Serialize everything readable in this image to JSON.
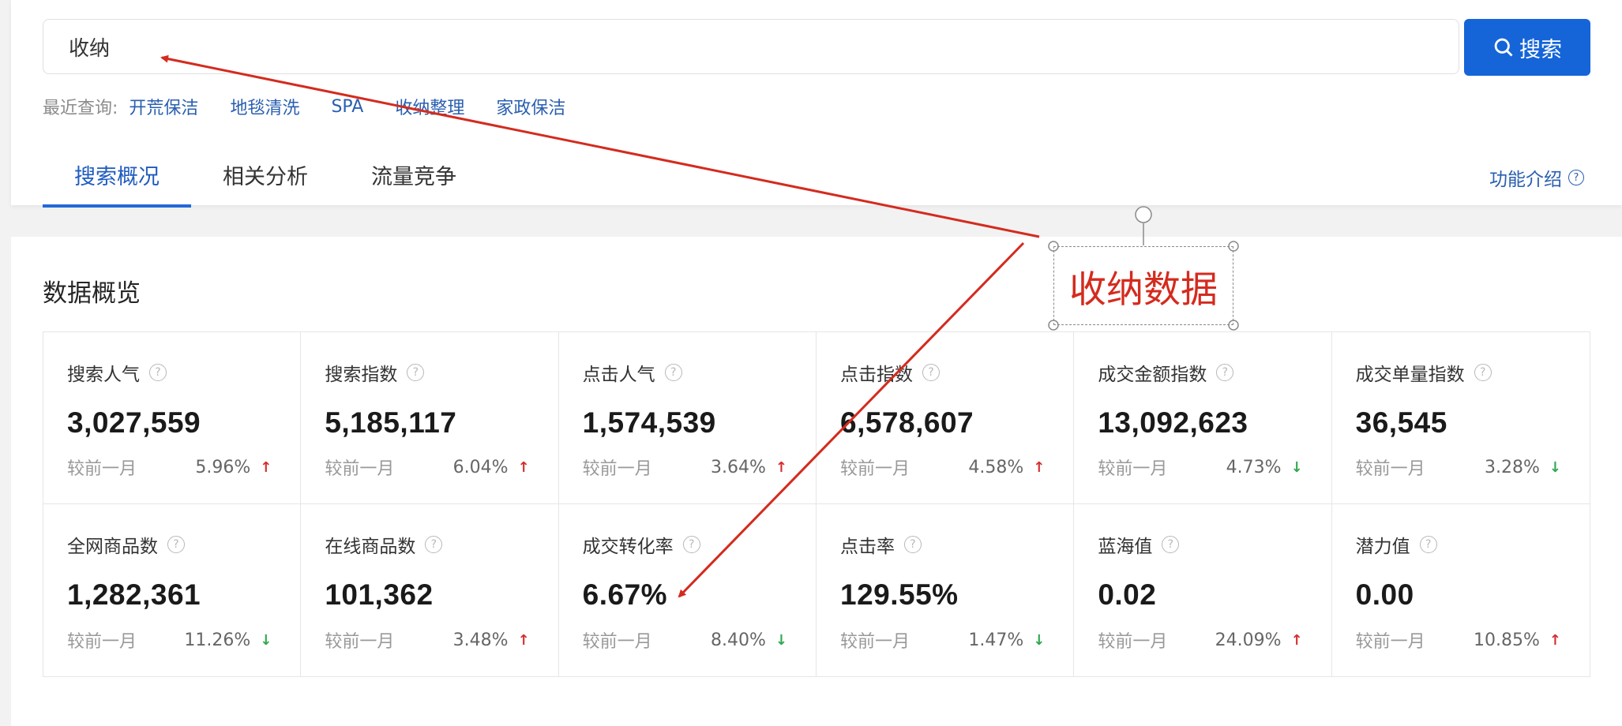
{
  "search": {
    "value": "收纳",
    "button_label": "搜索"
  },
  "recent": {
    "label": "最近查询:",
    "links": [
      "开荒保洁",
      "地毯清洗",
      "SPA",
      "收纳整理",
      "家政保洁"
    ]
  },
  "tabs": [
    {
      "label": "搜索概况",
      "active": true
    },
    {
      "label": "相关分析",
      "active": false
    },
    {
      "label": "流量竞争",
      "active": false
    }
  ],
  "func_intro": {
    "label": "功能介绍",
    "icon": "question-circle-icon"
  },
  "overview": {
    "title": "数据概览",
    "compare_label": "较前一月",
    "metrics": [
      {
        "label": "搜索人气",
        "value": "3,027,559",
        "change": "5.96%",
        "trend": "up"
      },
      {
        "label": "搜索指数",
        "value": "5,185,117",
        "change": "6.04%",
        "trend": "up"
      },
      {
        "label": "点击人气",
        "value": "1,574,539",
        "change": "3.64%",
        "trend": "up"
      },
      {
        "label": "点击指数",
        "value": "6,578,607",
        "change": "4.58%",
        "trend": "up"
      },
      {
        "label": "成交金额指数",
        "value": "13,092,623",
        "change": "4.73%",
        "trend": "down"
      },
      {
        "label": "成交单量指数",
        "value": "36,545",
        "change": "3.28%",
        "trend": "down"
      },
      {
        "label": "全网商品数",
        "value": "1,282,361",
        "change": "11.26%",
        "trend": "down"
      },
      {
        "label": "在线商品数",
        "value": "101,362",
        "change": "3.48%",
        "trend": "up"
      },
      {
        "label": "成交转化率",
        "value": "6.67%",
        "change": "8.40%",
        "trend": "down"
      },
      {
        "label": "点击率",
        "value": "129.55%",
        "change": "1.47%",
        "trend": "down"
      },
      {
        "label": "蓝海值",
        "value": "0.02",
        "change": "24.09%",
        "trend": "up"
      },
      {
        "label": "潜力值",
        "value": "0.00",
        "change": "10.85%",
        "trend": "up"
      }
    ]
  },
  "annotation": {
    "text": "收纳数据",
    "color": "#d42b1e"
  },
  "colors": {
    "accent": "#1565d8",
    "up": "#d62d2d",
    "down": "#2fa84f"
  }
}
